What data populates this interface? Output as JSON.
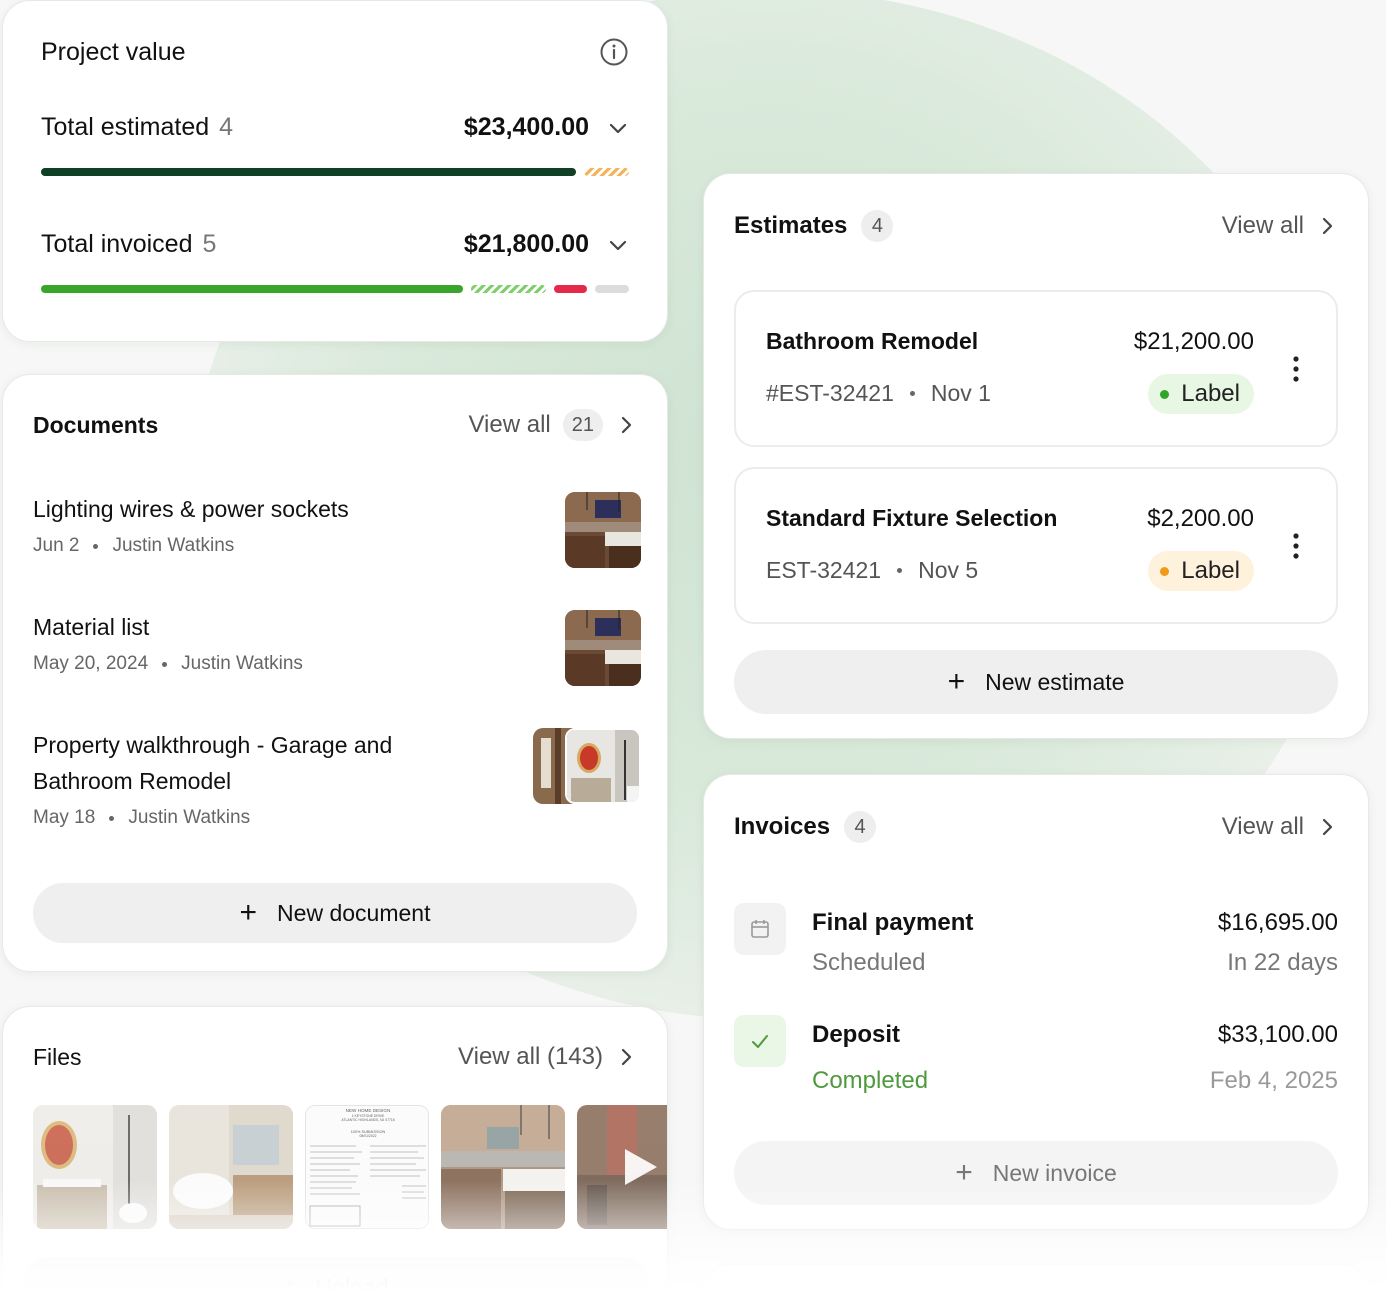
{
  "project_value": {
    "title": "Project value",
    "estimated": {
      "label": "Total estimated",
      "count": "4",
      "amount": "$23,400.00"
    },
    "invoiced": {
      "label": "Total invoiced",
      "count": "5",
      "amount": "$21,800.00"
    },
    "estimated_progress": {
      "solid_fraction": 0.92,
      "pending_fraction": 0.08
    },
    "invoiced_progress": {
      "paid_fraction": 0.73,
      "pending_fraction": 0.13,
      "overdue_fraction": 0.06,
      "remaining_fraction": 0.06
    },
    "colors": {
      "dark_green": "#0f3f24",
      "green": "#3aa52b",
      "red": "#e5294b",
      "grey": "#dcdcdc",
      "orange": "#f3b45b"
    }
  },
  "documents": {
    "title": "Documents",
    "view_all": "View all",
    "count": "21",
    "items": [
      {
        "title": "Lighting wires & power sockets",
        "date": "Jun 2",
        "author": "Justin Watkins"
      },
      {
        "title": "Material list",
        "date": "May 20, 2024",
        "author": "Justin Watkins"
      },
      {
        "title": "Property walkthrough - Garage and Bathroom Remodel",
        "date": "May 18",
        "author": "Justin Watkins"
      }
    ],
    "new_label": "New document"
  },
  "files": {
    "title": "Files",
    "view_all": "View all (143)",
    "upload_label": "Upload",
    "doc_thumb_lines": [
      "NEW HOME DESIGN",
      "1 KEYSTONE DRIVE",
      "ATLANTIC HIGHLANDS, NJ 07716",
      "100% SUBMISSION",
      "08/01/2022"
    ]
  },
  "estimates": {
    "title": "Estimates",
    "count": "4",
    "view_all": "View all",
    "items": [
      {
        "name": "Bathroom Remodel",
        "amount": "$21,200.00",
        "number": "#EST-32421",
        "date": "Nov 1",
        "label": "Label",
        "label_color": "#2fa52a"
      },
      {
        "name": "Standard Fixture Selection",
        "amount": "$2,200.00",
        "number": "EST-32421",
        "date": "Nov 5",
        "label": "Label",
        "label_color": "#f29a16"
      }
    ],
    "new_label": "New estimate"
  },
  "invoices": {
    "title": "Invoices",
    "count": "4",
    "view_all": "View all",
    "items": [
      {
        "name": "Final payment",
        "status": "Scheduled",
        "amount": "$16,695.00",
        "when": "In 22 days",
        "icon": "calendar-icon"
      },
      {
        "name": "Deposit",
        "status": "Completed",
        "amount": "$33,100.00",
        "when": "Feb 4, 2025",
        "icon": "check-icon",
        "status_color": "#4f9a3f"
      }
    ],
    "new_label": "New invoice"
  }
}
